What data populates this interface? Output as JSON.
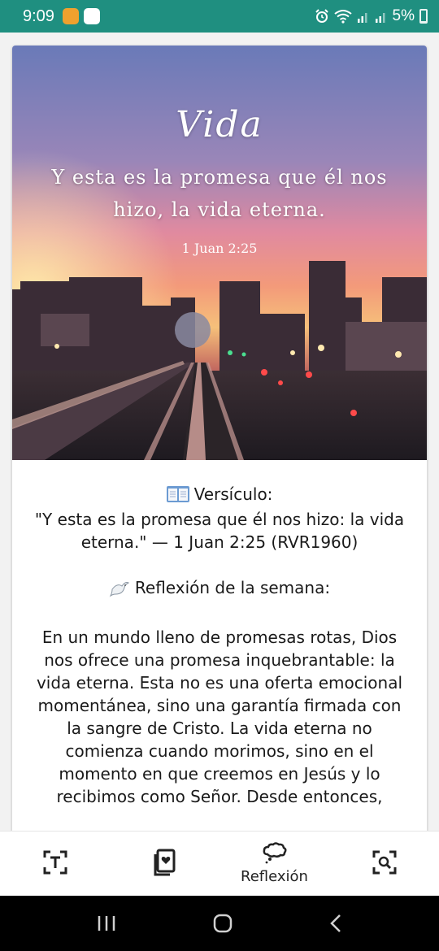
{
  "status_bar": {
    "time": "9:09",
    "battery": "5%",
    "icons": [
      "alarm-icon",
      "wifi-icon",
      "signal-icon",
      "signal-icon",
      "battery-icon"
    ]
  },
  "hero": {
    "title": "Vida",
    "verse": "Y esta es la promesa que él nos hizo, la vida eterna.",
    "reference": "1 Juan 2:25"
  },
  "content": {
    "verse_heading": "Versículo:",
    "verse_text": "\"Y esta es la promesa que él nos hizo: la vida eterna.\" — 1 Juan 2:25 (RVR1960)",
    "reflection_heading": "Reflexión de la semana:",
    "reflection_text": "En un mundo lleno de promesas rotas, Dios nos ofrece una promesa inquebrantable: la vida eterna. Esta no es una oferta emocional momentánea, sino una garantía firmada con la sangre de Cristo. La vida eterna no comienza cuando morimos, sino en el momento en que creemos en Jesús y lo recibimos como Señor. Desde entonces,"
  },
  "bottom_nav": {
    "items": [
      {
        "icon": "text-scan-icon",
        "label": ""
      },
      {
        "icon": "bible-heart-icon",
        "label": ""
      },
      {
        "icon": "thought-bubble-icon",
        "label": "Reflexión"
      },
      {
        "icon": "image-search-icon",
        "label": ""
      }
    ]
  },
  "colors": {
    "status_bar": "#1f8f80",
    "nav_background": "#ffffff",
    "system_nav": "#000000"
  }
}
